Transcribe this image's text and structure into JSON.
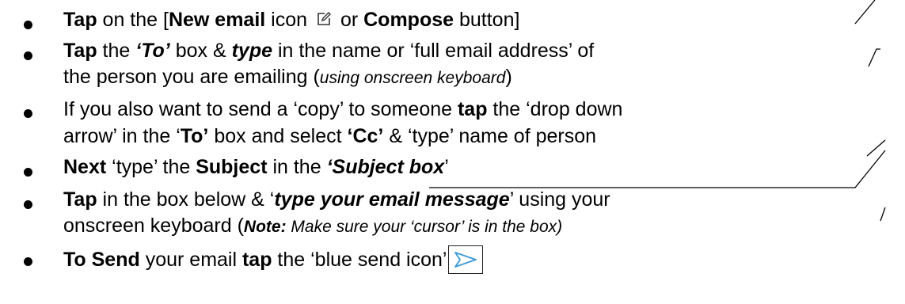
{
  "items": [
    {
      "lines": [
        [
          {
            "t": "Tap",
            "b": true
          },
          {
            "t": " on the ["
          },
          {
            "t": "New email",
            "b": true
          },
          {
            "t": "  icon "
          },
          {
            "icon": "compose-icon"
          },
          {
            "t": " or "
          },
          {
            "t": "Compose",
            "b": true
          },
          {
            "t": " button]"
          }
        ]
      ]
    },
    {
      "lines": [
        [
          {
            "t": "Tap",
            "b": true
          },
          {
            "t": " the "
          },
          {
            "t": "‘To’",
            "b": true,
            "i": true
          },
          {
            "t": " box & "
          },
          {
            "t": "type",
            "b": true,
            "i": true
          },
          {
            "t": " in the name or ‘full email address’ of"
          }
        ],
        [
          {
            "t": "the person you are emailing ("
          },
          {
            "t": "using onscreen keyboard",
            "i": true,
            "s": true
          },
          {
            "t": ")"
          }
        ]
      ]
    },
    {
      "lines": [
        [
          {
            "t": "If you also want to send a ‘copy’ to someone "
          },
          {
            "t": "tap",
            "b": true
          },
          {
            "t": " the ‘drop down"
          }
        ],
        [
          {
            "t": "arrow’ in the ‘"
          },
          {
            "t": "To’",
            "b": true
          },
          {
            "t": " box and select "
          },
          {
            "t": "‘Cc’",
            "b": true
          },
          {
            "t": " & ‘type’ name of person"
          }
        ]
      ]
    },
    {
      "lines": [
        [
          {
            "t": "Next",
            "b": true
          },
          {
            "t": " ‘type’ the "
          },
          {
            "t": "Subject",
            "b": true
          },
          {
            "t": " in the "
          },
          {
            "t": "‘Subject box",
            "b": true,
            "i": true
          },
          {
            "t": "’"
          }
        ]
      ]
    },
    {
      "lines": [
        [
          {
            "t": "Tap",
            "b": true
          },
          {
            "t": " in the box below & ‘"
          },
          {
            "t": "type your email message",
            "b": true,
            "i": true
          },
          {
            "t": "’ using your"
          }
        ],
        [
          {
            "t": "onscreen keyboard ("
          },
          {
            "t": "Note:",
            "b": true,
            "i": true,
            "s": true
          },
          {
            "t": " Make sure your ‘cursor’ is in the box)",
            "i": true,
            "s": true
          }
        ]
      ]
    },
    {
      "lines": [
        [
          {
            "t": "To Send",
            "b": true
          },
          {
            "t": " your email "
          },
          {
            "t": "tap",
            "b": true
          },
          {
            "t": " the ‘blue send icon’"
          },
          {
            "icon": "send-icon"
          }
        ]
      ]
    }
  ],
  "colors": {
    "text": "#000000",
    "send_icon": "#3a9ad9"
  }
}
